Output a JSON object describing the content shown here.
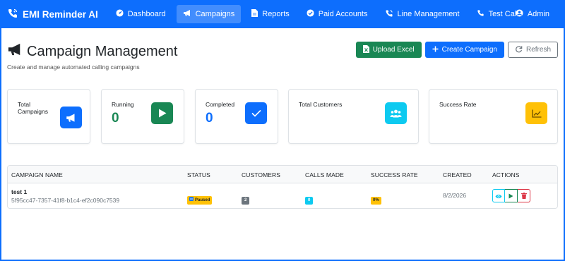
{
  "app": {
    "brand": "EMI Reminder AI"
  },
  "nav": {
    "items": [
      {
        "label": "Dashboard",
        "icon": "gauge-icon"
      },
      {
        "label": "Campaigns",
        "icon": "megaphone-icon",
        "active": true
      },
      {
        "label": "Reports",
        "icon": "file-icon"
      },
      {
        "label": "Paid Accounts",
        "icon": "check-circle-icon"
      },
      {
        "label": "Line Management",
        "icon": "phone-volume-icon"
      },
      {
        "label": "Test Call",
        "icon": "phone-icon"
      }
    ],
    "user": "Admin"
  },
  "header": {
    "title": "Campaign Management",
    "subtitle": "Create and manage automated calling campaigns",
    "buttons": {
      "upload": "Upload Excel",
      "create": "Create Campaign",
      "refresh": "Refresh"
    }
  },
  "stats": [
    {
      "label": "Total Campaigns",
      "value": "",
      "icon": "megaphone-icon",
      "color": "#0d6efd"
    },
    {
      "label": "Running",
      "value": "0",
      "icon": "play-icon",
      "color": "#198754"
    },
    {
      "label": "Completed",
      "value": "0",
      "icon": "check-icon",
      "color": "#0d6efd"
    },
    {
      "label": "Total Customers",
      "value": "",
      "icon": "users-icon",
      "color": "#0dcaf0"
    },
    {
      "label": "Success Rate",
      "value": "",
      "icon": "chart-line-icon",
      "color": "#ffc107"
    }
  ],
  "table": {
    "columns": [
      "CAMPAIGN NAME",
      "STATUS",
      "CUSTOMERS",
      "CALLS MADE",
      "SUCCESS RATE",
      "CREATED",
      "ACTIONS"
    ],
    "rows": [
      {
        "name": "test 1",
        "id": "5f95cc47-7357-41f8-b1c4-ef2c090c7539",
        "status": "Paused",
        "customers": "2",
        "calls_made": "0",
        "success_rate": "0%",
        "created": "8/2/2026"
      }
    ]
  },
  "colors": {
    "primary": "#0d6efd",
    "success": "#198754",
    "info": "#0dcaf0",
    "warning": "#ffc107",
    "danger": "#dc3545",
    "secondary": "#6c757d"
  }
}
